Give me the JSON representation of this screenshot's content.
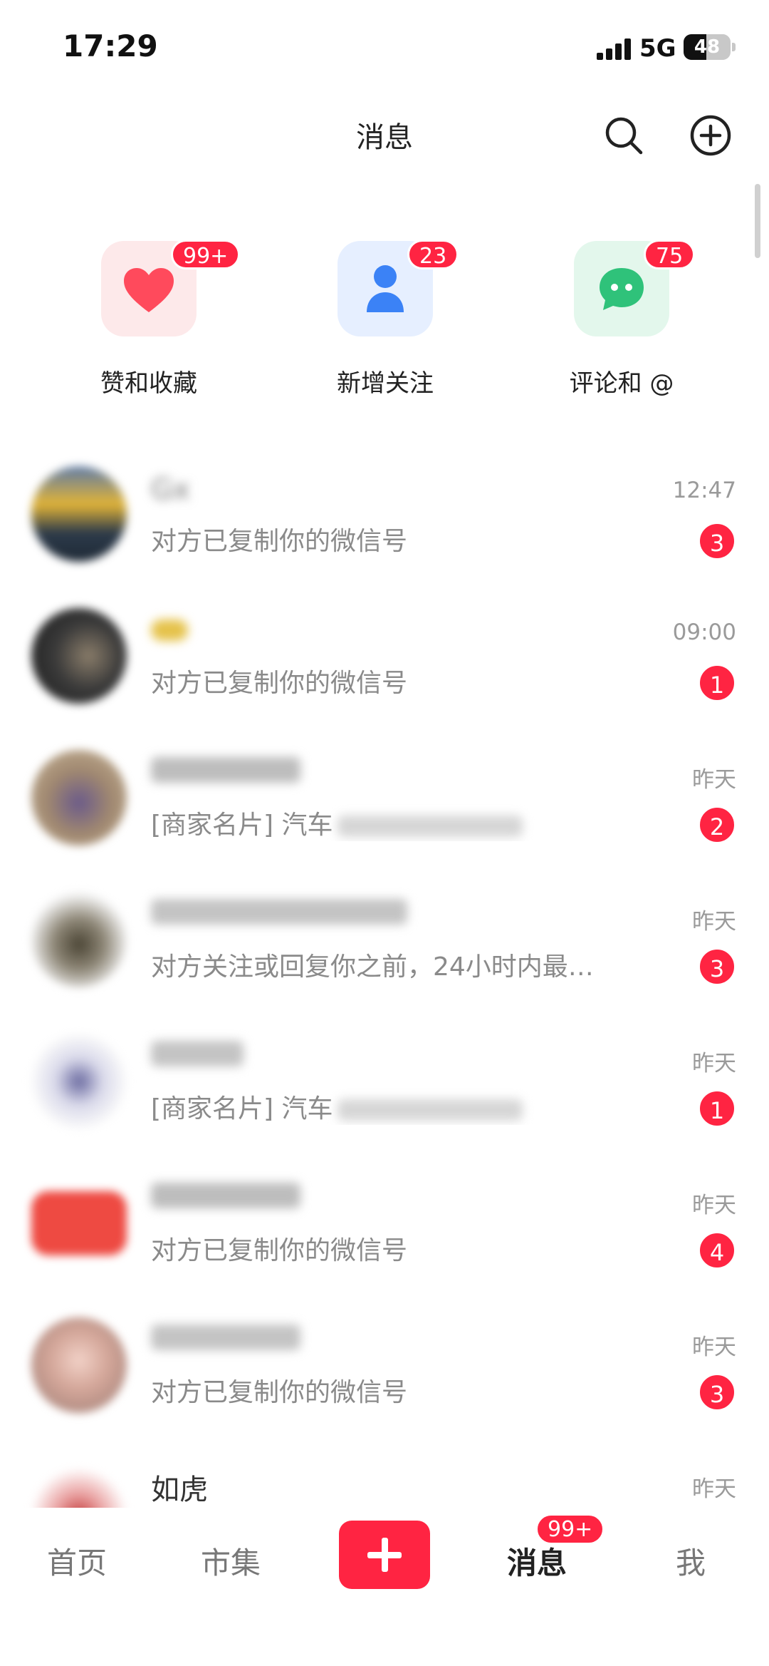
{
  "status_bar": {
    "time": "17:29",
    "network": "5G",
    "battery": "48",
    "battery_level_percent": 48
  },
  "header": {
    "title": "消息",
    "search_icon": "search-icon",
    "add_icon": "plus-circle-icon"
  },
  "shortcuts": [
    {
      "label": "赞和收藏",
      "badge": "99+",
      "icon": "heart-icon",
      "color": "#ff4a5c",
      "bg": "#fde9ea"
    },
    {
      "label": "新增关注",
      "badge": "23",
      "icon": "person-icon",
      "color": "#3b82f6",
      "bg": "#e6efff"
    },
    {
      "label": "评论和 @",
      "badge": "75",
      "icon": "chat-bubble-icon",
      "color": "#2fc27a",
      "bg": "#e3f7ec"
    }
  ],
  "messages": [
    {
      "name": "Gx",
      "preview": "对方已复制你的微信号",
      "preview_hidden": "",
      "time": "12:47",
      "unread": "3"
    },
    {
      "name": "",
      "preview": "对方已复制你的微信号",
      "preview_hidden": "",
      "time": "09:00",
      "unread": "1"
    },
    {
      "name": "",
      "preview": "[商家名片] 汽车",
      "preview_hidden": "",
      "time": "昨天",
      "unread": "2"
    },
    {
      "name": "",
      "preview": "对方关注或回复你之前，24小时内最…",
      "preview_hidden": "",
      "time": "昨天",
      "unread": "3"
    },
    {
      "name": "",
      "preview": "[商家名片] 汽车",
      "preview_hidden": "",
      "time": "昨天",
      "unread": "1"
    },
    {
      "name": "",
      "preview": "对方已复制你的微信号",
      "preview_hidden": "",
      "time": "昨天",
      "unread": "4"
    },
    {
      "name": "",
      "preview": "对方已复制你的微信号",
      "preview_hidden": "",
      "time": "昨天",
      "unread": "3"
    },
    {
      "name": "如虎",
      "preview": "",
      "preview_hidden": "",
      "time": "昨天",
      "unread": ""
    }
  ],
  "bottom_nav": {
    "home": "首页",
    "market": "市集",
    "messages": "消息",
    "messages_badge": "99+",
    "me": "我"
  },
  "colors": {
    "accent": "#ff2442"
  }
}
